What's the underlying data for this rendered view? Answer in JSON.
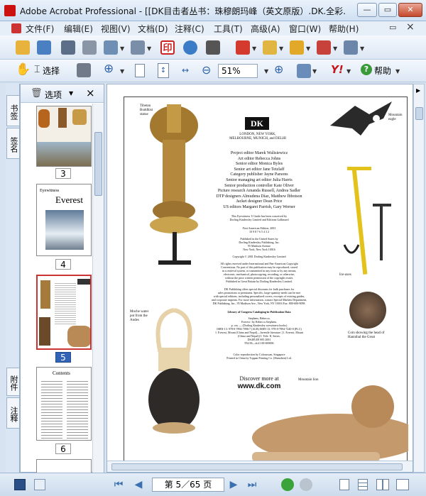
{
  "window": {
    "title": "Adobe Acrobat Professional - [[DK目击者丛书：珠穆朗玛峰（英文原版）.DK.全彩…",
    "min_label": "—",
    "max_label": "▭",
    "close_label": "✕",
    "doc_close_label": "×"
  },
  "menu": [
    "文件(F)",
    "编辑(E)",
    "视图(V)",
    "文档(D)",
    "注释(C)",
    "工具(T)",
    "高级(A)",
    "窗口(W)",
    "帮助(H)"
  ],
  "toolbar2": {
    "select_label": "选择",
    "zoom_value": "51%",
    "help_label": "帮助"
  },
  "nav_panel": {
    "options_label": "选项",
    "close_label": "×",
    "tabs": [
      "书签",
      "签名",
      "附件",
      "注释"
    ],
    "pages": [
      {
        "label": "3"
      },
      {
        "label": "4",
        "caption_small": "Eyewitness",
        "title": "Everest"
      },
      {
        "label": "5"
      },
      {
        "label": "6",
        "title": "Contents"
      }
    ]
  },
  "document_page": {
    "publisher_logo": "DK",
    "publisher_cities": [
      "LONDON, NEW YORK,",
      "MELBOURNE, MUNICH, and DELHI"
    ],
    "credits": [
      "Project editor  Marek Walisiewicz",
      "Art editor  Rebecca Johns",
      "Senior editor  Monica Byles",
      "Senior art editor  Jane Tetzlaff",
      "Category publisher  Jayne Parsons",
      "Senior managing art editor  Julia Harris",
      "Senior production controller  Kate Oliver",
      "Picture research  Amanda Russell, Andrea Sadler",
      "DTP designers  Almudena Díaz, Matthew Ibbotson",
      "Jacket designer  Dean Price",
      "US editors  Margaret Parrish, Gary Werner"
    ],
    "blurb": [
      "This Eyewitness ® Guide has been conceived by",
      "Dorling Kindersley Limited and Editions Gallimard"
    ],
    "edition": [
      "First American Edition, 2001",
      "10 9 8 7 6 5 4 3 2"
    ],
    "published": [
      "Published in the United States by",
      "Dorling Kindersley Publishing, Inc.",
      "95 Madison Avenue",
      "New York, New York 10016"
    ],
    "copyright": "Copyright © 2001 Dorling Kindersley Limited",
    "rights": [
      "All rights reserved under International and Pan-American Copyright",
      "Conventions. No part of this publication may be reproduced, stored",
      "in a retrieval system, or transmitted in any form or by any means,",
      "electronic, mechanical, photocopying, recording, or otherwise,",
      "without the prior written permission of the copyright owner.",
      "Published in Great Britain by Dorling Kindersley Limited."
    ],
    "discounts": [
      "DK Publishing offers special discounts for bulk purchases for",
      "sales promotions or premiums. Specific, large-quantity needs can be met",
      "with special editions, including personalized covers, excerpts of existing guides,",
      "and corporate imprints. For more information, contact Special Markets Department,",
      "DK Publishing, Inc., 95 Madison Ave., New York, NY 10016 Fax: 800-600-9098."
    ],
    "cip_title": "Library of Congress Cataloging-in-Publication Data",
    "cip": [
      "Stephens, Rebecca.",
      "Everest / by Rebecca Stephens.",
      "p. cm. — (Dorling Kindersley eyewitness books)",
      "ISBN-13: 978-0-7894-7096-7 (ALB) ISBN-13: 978-0-7894-7240-0 (PLC)",
      "1. Everest, Mount (China and Nepal)—Juvenile literature. [1. Everest, Mount",
      "(China and Nepal)] I. Title. II. Series.",
      "DS485.E8 S85 2001",
      "954.96—dc21    00-069696"
    ],
    "print": [
      "Color reproduction by Colourscan, Singapore",
      "Printed in China by Toppan Printing Co. (Shenzhen) Ltd."
    ],
    "discover": "Discover more at",
    "url": "www.dk.com",
    "captions": {
      "statue": "Tibetan Buddhist statue",
      "eagle": "Mountain eagle",
      "axes": "Ice-axes",
      "vessel": "Moche water pot from the Andes",
      "coin": "Coin showing the head of Hannibal the Great",
      "lion": "Mountain lion"
    }
  },
  "status": {
    "page_text": "第 5／65 页"
  }
}
